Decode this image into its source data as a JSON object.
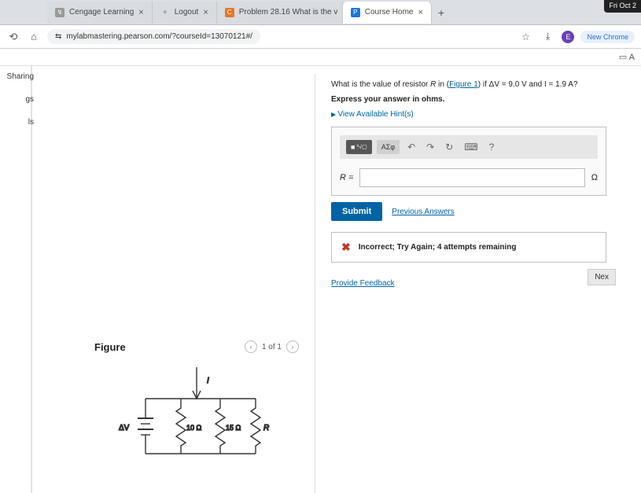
{
  "os": {
    "clock": "Fri Oct 2"
  },
  "browser": {
    "tabs": [
      {
        "label": "Cengage Learning"
      },
      {
        "label": "Logout"
      },
      {
        "label": "Problem 28.16 What is the v"
      },
      {
        "label": "Course Home"
      }
    ],
    "url": "mylabmastering.pearson.com/?courseId=13070121#/",
    "new_chrome": "New Chrome"
  },
  "sidebar": {
    "items": [
      "Sharing",
      "gs",
      "ls"
    ]
  },
  "figure": {
    "title": "Figure",
    "pager": "1 of 1",
    "labels": {
      "dv": "ΔV",
      "r1": "10 Ω",
      "r2": "15 Ω",
      "r3": "R",
      "i": "I"
    }
  },
  "question": {
    "prompt_pre": "What is the value of resistor ",
    "prompt_var": "R",
    "prompt_mid": " in (",
    "prompt_link": "Figure 1",
    "prompt_post": ") if ΔV = 9.0 V and I = 1.9 A?",
    "instruction": "Express your answer in ohms.",
    "hints": "View Available Hint(s)",
    "input_label": "R =",
    "unit": "Ω",
    "toolbar": {
      "greek": "ΑΣφ",
      "help": "?"
    },
    "submit": "Submit",
    "previous": "Previous Answers",
    "feedback": "Incorrect; Try Again; 4 attempts remaining",
    "provide_feedback": "Provide Feedback",
    "next": "Nex"
  }
}
